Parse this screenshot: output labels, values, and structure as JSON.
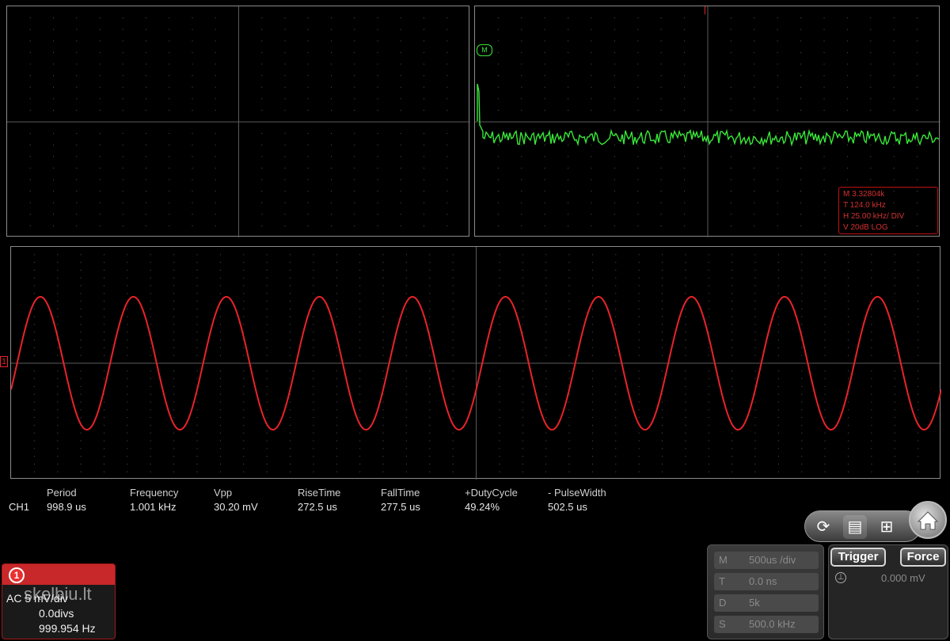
{
  "colors": {
    "grid": "#5a5a5a",
    "ch1_trace": "#e8232a",
    "fft_trace": "#38e838",
    "panel_border": "#8a8a8a"
  },
  "fft": {
    "marker": "M",
    "info": {
      "m": "M  3.32804k",
      "t": "T  124.0 kHz",
      "h": "H  25.00 kHz/ DIV",
      "v": "V  20dB  LOG"
    }
  },
  "waveform": {
    "channel_marker": "1",
    "cycles_visible": 10
  },
  "measurements": {
    "channel": "CH1",
    "items": [
      {
        "label": "Period",
        "value": "998.9 us"
      },
      {
        "label": "Frequency",
        "value": "1.001 kHz"
      },
      {
        "label": "Vpp",
        "value": "30.20 mV"
      },
      {
        "label": "RiseTime",
        "value": "272.5 us"
      },
      {
        "label": "FallTime",
        "value": "277.5 us"
      },
      {
        "label": "+DutyCycle",
        "value": "49.24%"
      },
      {
        "label": "- PulseWidth",
        "value": "502.5 us"
      }
    ]
  },
  "channel_panel": {
    "badge": "1",
    "coupling_scale": "AC  5 mV/div",
    "offset": "0.0divs",
    "frequency": "999.954 Hz"
  },
  "timebase": {
    "m_key": "M",
    "m_value": "500us /div",
    "t_key": "T",
    "t_value": "0.0 ns",
    "d_key": "D",
    "d_value": "5k",
    "s_key": "S",
    "s_value": "500.0 kHz"
  },
  "trigger": {
    "trigger_button": "Trigger",
    "force_button": "Force",
    "level": "0.000 mV"
  },
  "toolbar": {
    "icons": [
      "autoset-icon",
      "save-icon",
      "layout-icon",
      "home-icon"
    ]
  },
  "watermark": "skelbiu.lt"
}
